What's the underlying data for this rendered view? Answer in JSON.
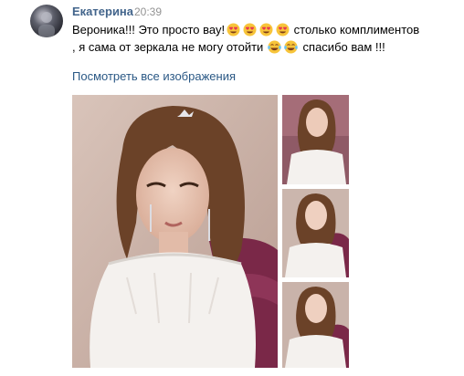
{
  "post": {
    "author": "Екатерина",
    "time": "20:39",
    "line1_a": "Вероника!!! Это просто вау!",
    "line1_emoji": [
      "heart-eyes",
      "heart-eyes",
      "heart-eyes",
      "heart-eyes"
    ],
    "line1_b": " столько комплиментов",
    "line2_a": ", я сама от зеркала не могу отойти ",
    "line2_emoji": [
      "tears-of-joy",
      "tears-of-joy"
    ],
    "line2_b": " спасибо вам !!!",
    "see_all": "Посмотреть все изображения"
  },
  "photos": {
    "main": "bride-portrait",
    "thumbs": [
      "bride-thumb-1",
      "bride-thumb-2",
      "bride-thumb-3"
    ]
  },
  "colors": {
    "author": "#42648b",
    "link": "#2a5885",
    "time": "#939393",
    "background_wall": "#c9b2a8",
    "sofa": "#7a2848",
    "dress": "#f4f1ee",
    "hair": "#6b4228"
  }
}
